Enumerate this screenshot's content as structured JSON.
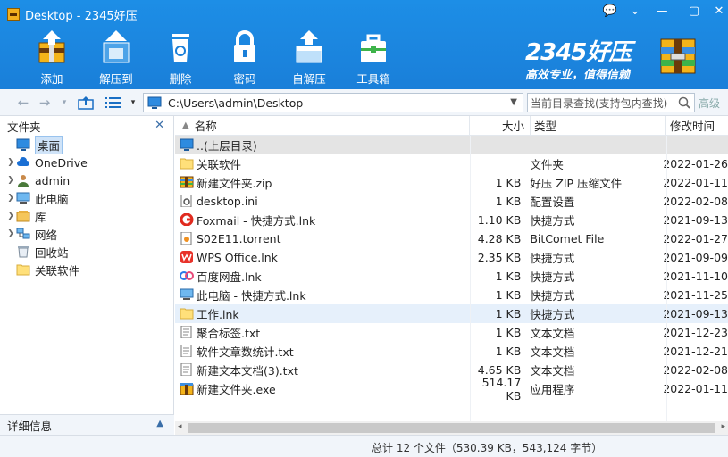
{
  "window": {
    "title": "Desktop - 2345好压",
    "controls": [
      "💬",
      "⌄",
      "—",
      "✕"
    ]
  },
  "toolbar": {
    "items": [
      {
        "label": "添加",
        "icon": "add-archive-icon"
      },
      {
        "label": "解压到",
        "icon": "extract-icon"
      },
      {
        "label": "删除",
        "icon": "recycle-bin-icon"
      },
      {
        "label": "密码",
        "icon": "lock-icon"
      },
      {
        "label": "自解压",
        "icon": "self-extract-icon"
      },
      {
        "label": "工具箱",
        "icon": "toolbox-icon"
      }
    ]
  },
  "brand": {
    "name": "2345好压",
    "slogan": "高效专业，值得信赖"
  },
  "address": {
    "path": "C:\\Users\\admin\\Desktop",
    "search_placeholder": "当前目录查找(支持包内查找)",
    "advanced": "高级"
  },
  "leftpanel": {
    "title": "文件夹",
    "footer": "详细信息",
    "items": [
      {
        "label": "桌面",
        "icon": "desktop-icon",
        "expandable": false,
        "selected": true
      },
      {
        "label": "OneDrive",
        "icon": "cloud-icon",
        "expandable": true
      },
      {
        "label": "admin",
        "icon": "user-icon",
        "expandable": true
      },
      {
        "label": "此电脑",
        "icon": "computer-icon",
        "expandable": true
      },
      {
        "label": "库",
        "icon": "library-icon",
        "expandable": true
      },
      {
        "label": "网络",
        "icon": "network-icon",
        "expandable": true
      },
      {
        "label": "回收站",
        "icon": "recycle-bin-icon",
        "expandable": false
      },
      {
        "label": "关联软件",
        "icon": "folder-icon",
        "expandable": false
      }
    ]
  },
  "filelist": {
    "columns": {
      "name": "名称",
      "size": "大小",
      "type": "类型",
      "date": "修改时间"
    },
    "rows": [
      {
        "name": "..(上层目录)",
        "size": "",
        "type": "",
        "date": "",
        "icon": "up-folder-icon"
      },
      {
        "name": "关联软件",
        "size": "",
        "type": "文件夹",
        "date": "2022-01-26",
        "icon": "folder-icon"
      },
      {
        "name": "新建文件夹.zip",
        "size": "1 KB",
        "type": "好压 ZIP 压缩文件",
        "date": "2022-01-11",
        "icon": "zip-icon"
      },
      {
        "name": "desktop.ini",
        "size": "1 KB",
        "type": "配置设置",
        "date": "2022-02-08",
        "icon": "ini-icon"
      },
      {
        "name": "Foxmail - 快捷方式.lnk",
        "size": "1.10 KB",
        "type": "快捷方式",
        "date": "2021-09-13",
        "icon": "foxmail-icon"
      },
      {
        "name": "S02E11.torrent",
        "size": "4.28 KB",
        "type": "BitComet File",
        "date": "2022-01-27",
        "icon": "torrent-icon"
      },
      {
        "name": "WPS Office.lnk",
        "size": "2.35 KB",
        "type": "快捷方式",
        "date": "2021-09-09",
        "icon": "wps-icon"
      },
      {
        "name": "百度网盘.lnk",
        "size": "1 KB",
        "type": "快捷方式",
        "date": "2021-11-10",
        "icon": "baidu-icon"
      },
      {
        "name": "此电脑 - 快捷方式.lnk",
        "size": "1 KB",
        "type": "快捷方式",
        "date": "2021-11-25",
        "icon": "computer-icon"
      },
      {
        "name": "工作.lnk",
        "size": "1 KB",
        "type": "快捷方式",
        "date": "2021-09-13",
        "icon": "folder-icon"
      },
      {
        "name": "聚合标签.txt",
        "size": "1 KB",
        "type": "文本文档",
        "date": "2021-12-23",
        "icon": "text-icon"
      },
      {
        "name": "软件文章数统计.txt",
        "size": "1 KB",
        "type": "文本文档",
        "date": "2021-12-21",
        "icon": "text-icon"
      },
      {
        "name": "新建文本文档(3).txt",
        "size": "4.65 KB",
        "type": "文本文档",
        "date": "2022-02-08",
        "icon": "text-icon"
      },
      {
        "name": "新建文件夹.exe",
        "size": "514.17 KB",
        "type": "应用程序",
        "date": "2022-01-11",
        "icon": "exe-icon"
      }
    ]
  },
  "status": {
    "text": "总计 12 个文件（530.39 KB，543,124 字节）"
  }
}
